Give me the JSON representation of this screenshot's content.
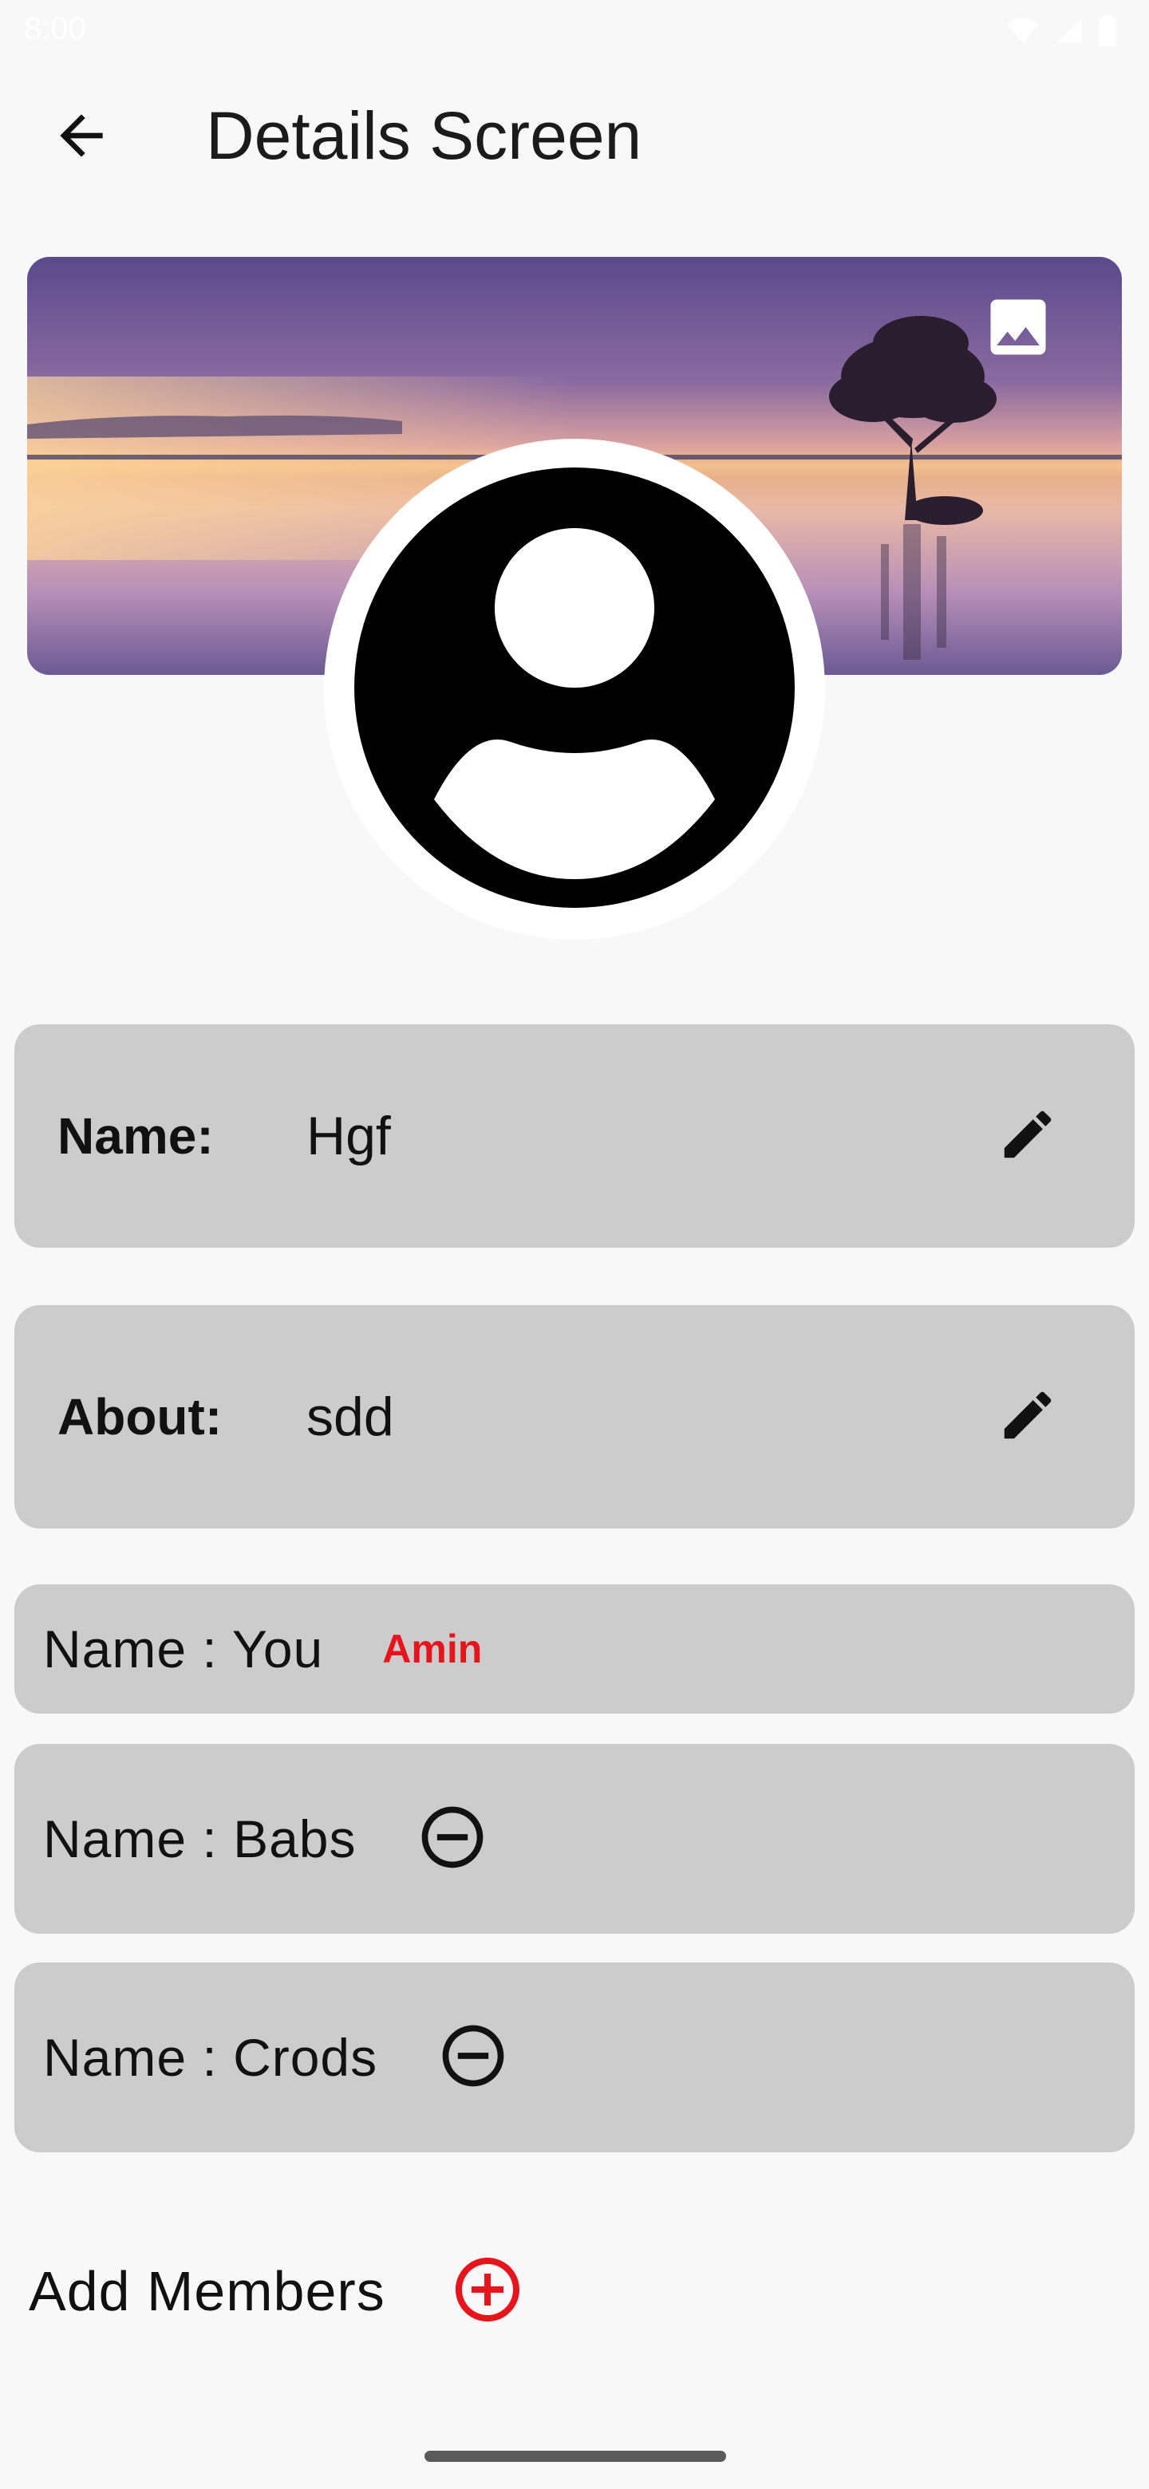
{
  "status_bar": {
    "time": "8:00",
    "icons": [
      "wifi-icon",
      "signal-icon",
      "battery-icon"
    ]
  },
  "app_bar": {
    "title": "Details Screen",
    "back_icon": "arrow-back-icon"
  },
  "cover": {
    "image": "sunset-lake-tree-photo",
    "change_icon": "image-icon"
  },
  "avatar": {
    "icon": "account-circle-icon"
  },
  "fields": [
    {
      "label": "Name:",
      "value": "Hgf",
      "action_icon": "edit-pencil-icon"
    },
    {
      "label": "About:",
      "value": "sdd",
      "action_icon": "edit-pencil-icon"
    }
  ],
  "members": [
    {
      "name": "Name : You",
      "role": "Amin"
    },
    {
      "name": "Name : Babs",
      "action_icon": "remove-circle-icon"
    },
    {
      "name": "Name : Crods",
      "action_icon": "remove-circle-icon"
    }
  ],
  "add_members": {
    "label": "Add Members",
    "icon": "add-circle-icon"
  },
  "colors": {
    "background": "#f8f8f8",
    "card": "#cccccc",
    "accent_red": "#e8141c"
  }
}
